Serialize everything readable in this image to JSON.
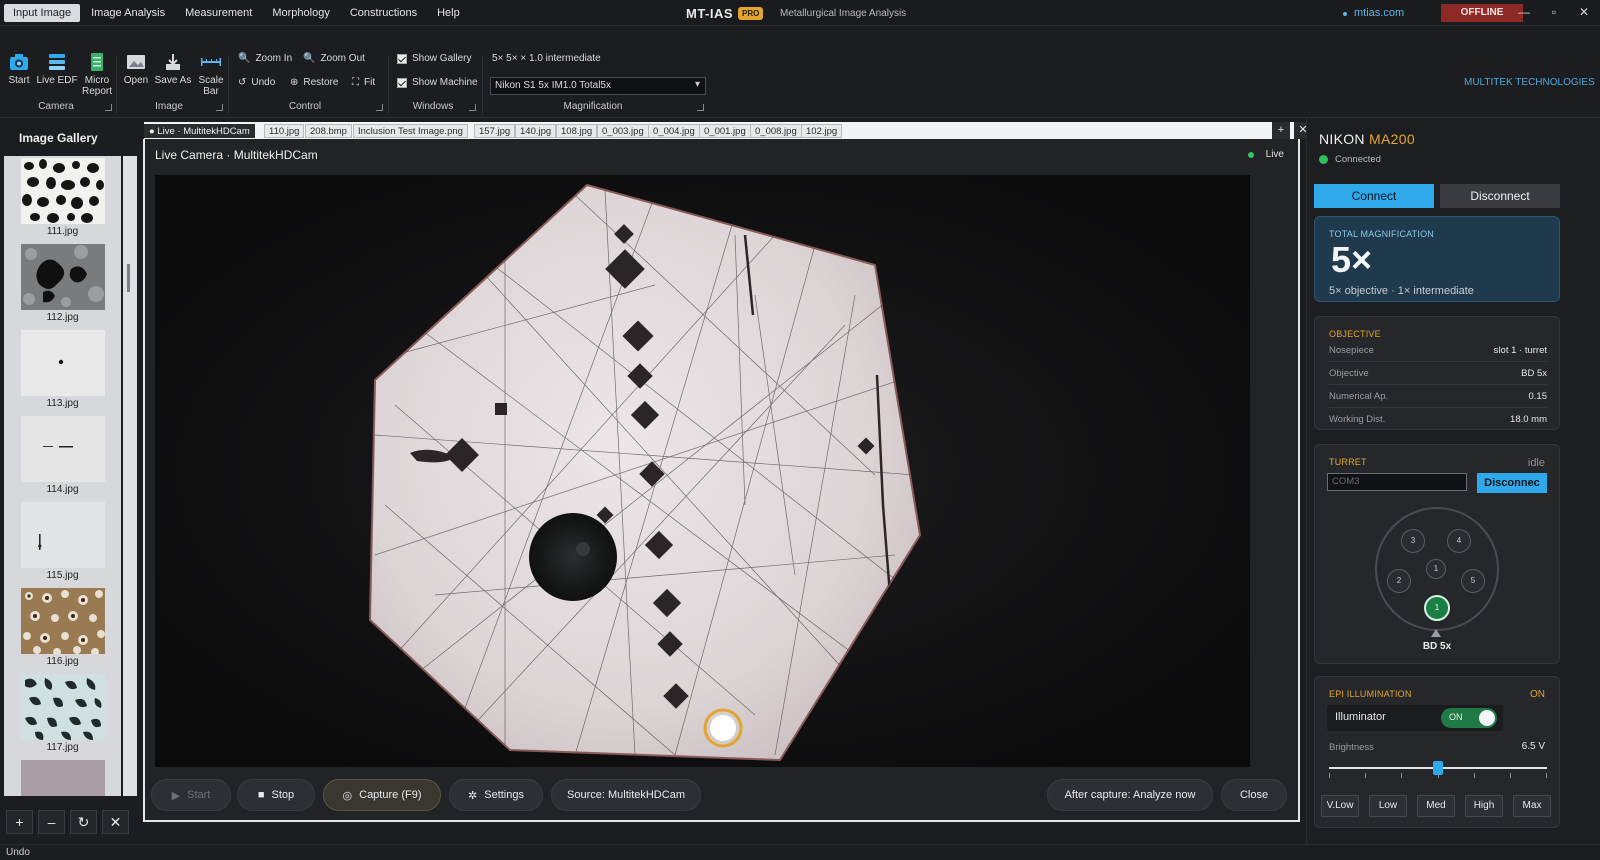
{
  "window": {
    "app_title": "MT-IAS",
    "badge": "PRO",
    "subtitle": "Metallurgical Image Analysis",
    "site": "mtias.com",
    "status_button": "OFFLINE",
    "minimize": "—",
    "maximize": "▫",
    "close": "✕"
  },
  "menu": [
    "Input Image",
    "Image Analysis",
    "Measurement",
    "Morphology",
    "Constructions",
    "Help"
  ],
  "ribbon": {
    "camera": {
      "label": "Camera",
      "start": "Start",
      "live_edf": "Live EDF",
      "micro_report_1": "Micro",
      "micro_report_2": "Report"
    },
    "image": {
      "label": "Image",
      "open": "Open",
      "save_as": "Save As",
      "scale_bar_1": "Scale",
      "scale_bar_2": "Bar"
    },
    "control": {
      "label": "Control",
      "zoom_in": "Zoom In",
      "zoom_out": "Zoom Out",
      "undo": "Undo",
      "restore": "Restore",
      "fit": "Fit"
    },
    "windows": {
      "label": "Windows",
      "show_gallery": "Show Gallery",
      "show_machine": "Show Machine"
    },
    "magnification": {
      "label": "Magnification",
      "summary": "5×  5×  ×  1.0 intermediate",
      "selected": "Nikon S1 5x IM1.0 Total5x"
    },
    "brand": "MULTITEK TECHNOLOGIES"
  },
  "gallery": {
    "title": "Image Gallery",
    "items": [
      "111.jpg",
      "112.jpg",
      "113.jpg",
      "114.jpg",
      "115.jpg",
      "116.jpg",
      "117.jpg"
    ],
    "buttons": [
      "+",
      "–",
      "↻",
      "✕"
    ]
  },
  "tabs": {
    "items": [
      "● Live · MultitekHDCam",
      "110.jpg",
      "208.bmp",
      "Inclusion Test Image.png",
      "157.jpg",
      "140.jpg",
      "108.jpg",
      "0_003.jpg",
      "0_004.jpg",
      "0_001.jpg",
      "0_008.jpg",
      "102.jpg"
    ],
    "add": "+",
    "close": "✕"
  },
  "live": {
    "title": "Live Camera  ·  MultitekHDCam",
    "status": "Live",
    "controls": {
      "start": "Start",
      "stop": "Stop",
      "capture": "Capture   (F9)",
      "settings": "Settings",
      "source": "Source:  MultitekHDCam",
      "after_capture": "After capture:  Analyze now",
      "close": "Close"
    }
  },
  "statusbar": {
    "text": "Undo"
  },
  "machine": {
    "title_main": "NIKON",
    "title_accent": "MA200",
    "connection": "Connected",
    "connect": "Connect",
    "disconnect": "Disconnect",
    "total_mag": {
      "head": "TOTAL MAGNIFICATION",
      "value": "5×",
      "sub": "5× objective   ·   1× intermediate"
    },
    "objective": {
      "head": "OBJECTIVE",
      "rows": [
        {
          "k": "Nosepiece",
          "v": "slot 1  ·  turret"
        },
        {
          "k": "Objective",
          "v": "BD 5x"
        },
        {
          "k": "Numerical Ap.",
          "v": "0.15"
        },
        {
          "k": "Working Dist.",
          "v": "18.0 mm"
        }
      ]
    },
    "turret": {
      "head": "TURRET",
      "state": "idle",
      "port": "COM3",
      "disconnect": "Disconnec",
      "slots": [
        "1",
        "2",
        "3",
        "4",
        "5"
      ],
      "center": "1",
      "active_slot": "1",
      "label": "BD 5x"
    },
    "epi": {
      "head": "EPI ILLUMINATION",
      "state": "ON",
      "illuminator": "Illuminator",
      "toggle": "ON",
      "brightness_label": "Brightness",
      "brightness_value": "6.5 V",
      "brightness_fraction": 0.5,
      "presets": [
        "V.Low",
        "Low",
        "Med",
        "High",
        "Max"
      ]
    }
  },
  "colors": {
    "accent": "#2fa9ea",
    "gold": "#e2a530",
    "connected": "#2fbf5e",
    "offline": "#8e2a25"
  }
}
